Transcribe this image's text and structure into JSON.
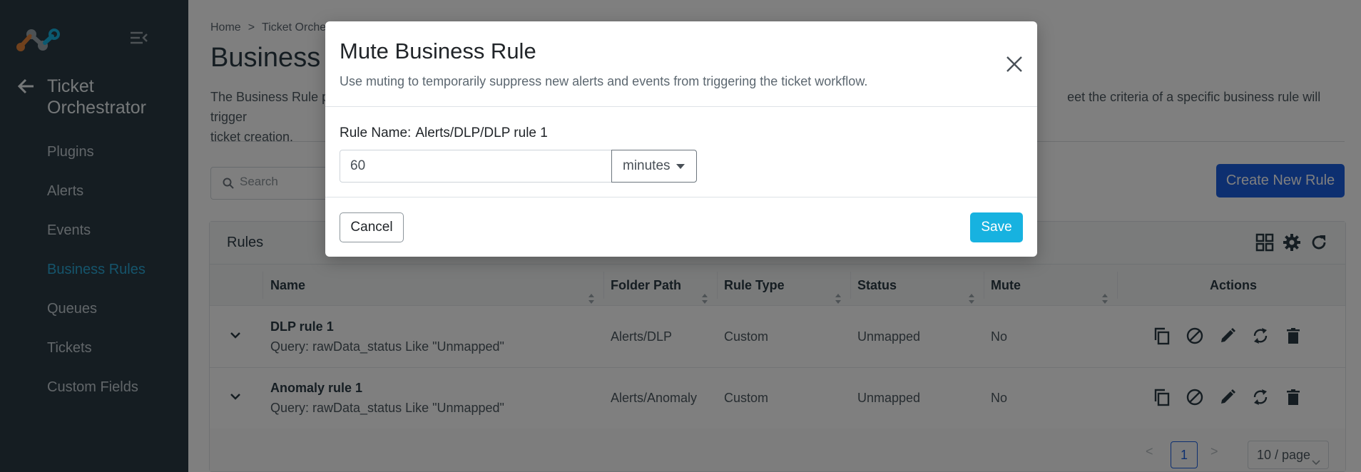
{
  "sidebar": {
    "app_title": "Ticket Orchestrator",
    "items": [
      {
        "label": "Plugins"
      },
      {
        "label": "Alerts"
      },
      {
        "label": "Events"
      },
      {
        "label": "Business Rules",
        "active": true
      },
      {
        "label": "Queues"
      },
      {
        "label": "Tickets"
      },
      {
        "label": "Custom Fields"
      }
    ]
  },
  "breadcrumb": [
    "Home",
    "Ticket Orche"
  ],
  "page": {
    "title": "Business R",
    "description_start": "The Business Rule p",
    "description_end": "eet the criteria of a specific business rule will trigger",
    "description_line2": "ticket creation."
  },
  "search": {
    "placeholder": "Search"
  },
  "create_button": "Create New Rule",
  "rules_card": {
    "title": "Rules",
    "columns": [
      "Name",
      "Folder Path",
      "Rule Type",
      "Status",
      "Mute",
      "Actions"
    ],
    "rows": [
      {
        "name": "DLP rule 1",
        "query": "Query: rawData_status Like \"Unmapped\"",
        "folder_path": "Alerts/DLP",
        "rule_type": "Custom",
        "status": "Unmapped",
        "mute": "No"
      },
      {
        "name": "Anomaly rule 1",
        "query": "Query: rawData_status Like \"Unmapped\"",
        "folder_path": "Alerts/Anomaly",
        "rule_type": "Custom",
        "status": "Unmapped",
        "mute": "No"
      }
    ],
    "pagination": {
      "prev": "<",
      "current": "1",
      "next": ">",
      "page_size": "10 / page"
    }
  },
  "modal": {
    "title": "Mute Business Rule",
    "subtitle": "Use muting to temporarily suppress new alerts and events from triggering the ticket workflow.",
    "rule_name_label": "Rule Name:",
    "rule_name_value": "Alerts/DLP/DLP rule 1",
    "duration_value": "60",
    "unit": "minutes",
    "cancel_label": "Cancel",
    "save_label": "Save"
  },
  "colors": {
    "sidebar_bg": "#2b3a45",
    "active_nav": "#2aa8d6",
    "primary": "#1a5fe0",
    "save": "#17b2e0"
  }
}
